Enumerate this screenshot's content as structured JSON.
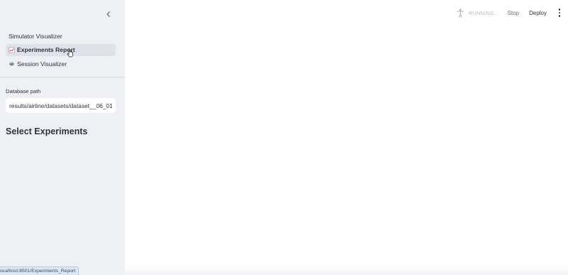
{
  "sidebar": {
    "collapse_icon": "chevron-left-icon",
    "nav": [
      {
        "label": "Simulator Visualizer",
        "icon": ""
      },
      {
        "label": "Experiments Report",
        "icon": "chart-increasing-icon",
        "active": true
      },
      {
        "label": "Session Visualizer",
        "icon": "bowl-icon"
      }
    ],
    "database_path": {
      "label": "Database path",
      "value": "results/airline/datasets/dataset__06_01_"
    },
    "section_heading": "Select Experiments",
    "status_url": "ocalhost:8501/Experiments_Report"
  },
  "toolbar": {
    "running_icon": "running-figure-icon",
    "running_text": "RUNNING...",
    "stop_label": "Stop",
    "deploy_label": "Deploy",
    "menu_icon": "vertical-dots-icon"
  },
  "colors": {
    "sidebar_bg": "#eef0f4",
    "active_nav_bg": "#dfe2e8",
    "text": "#31333f"
  }
}
